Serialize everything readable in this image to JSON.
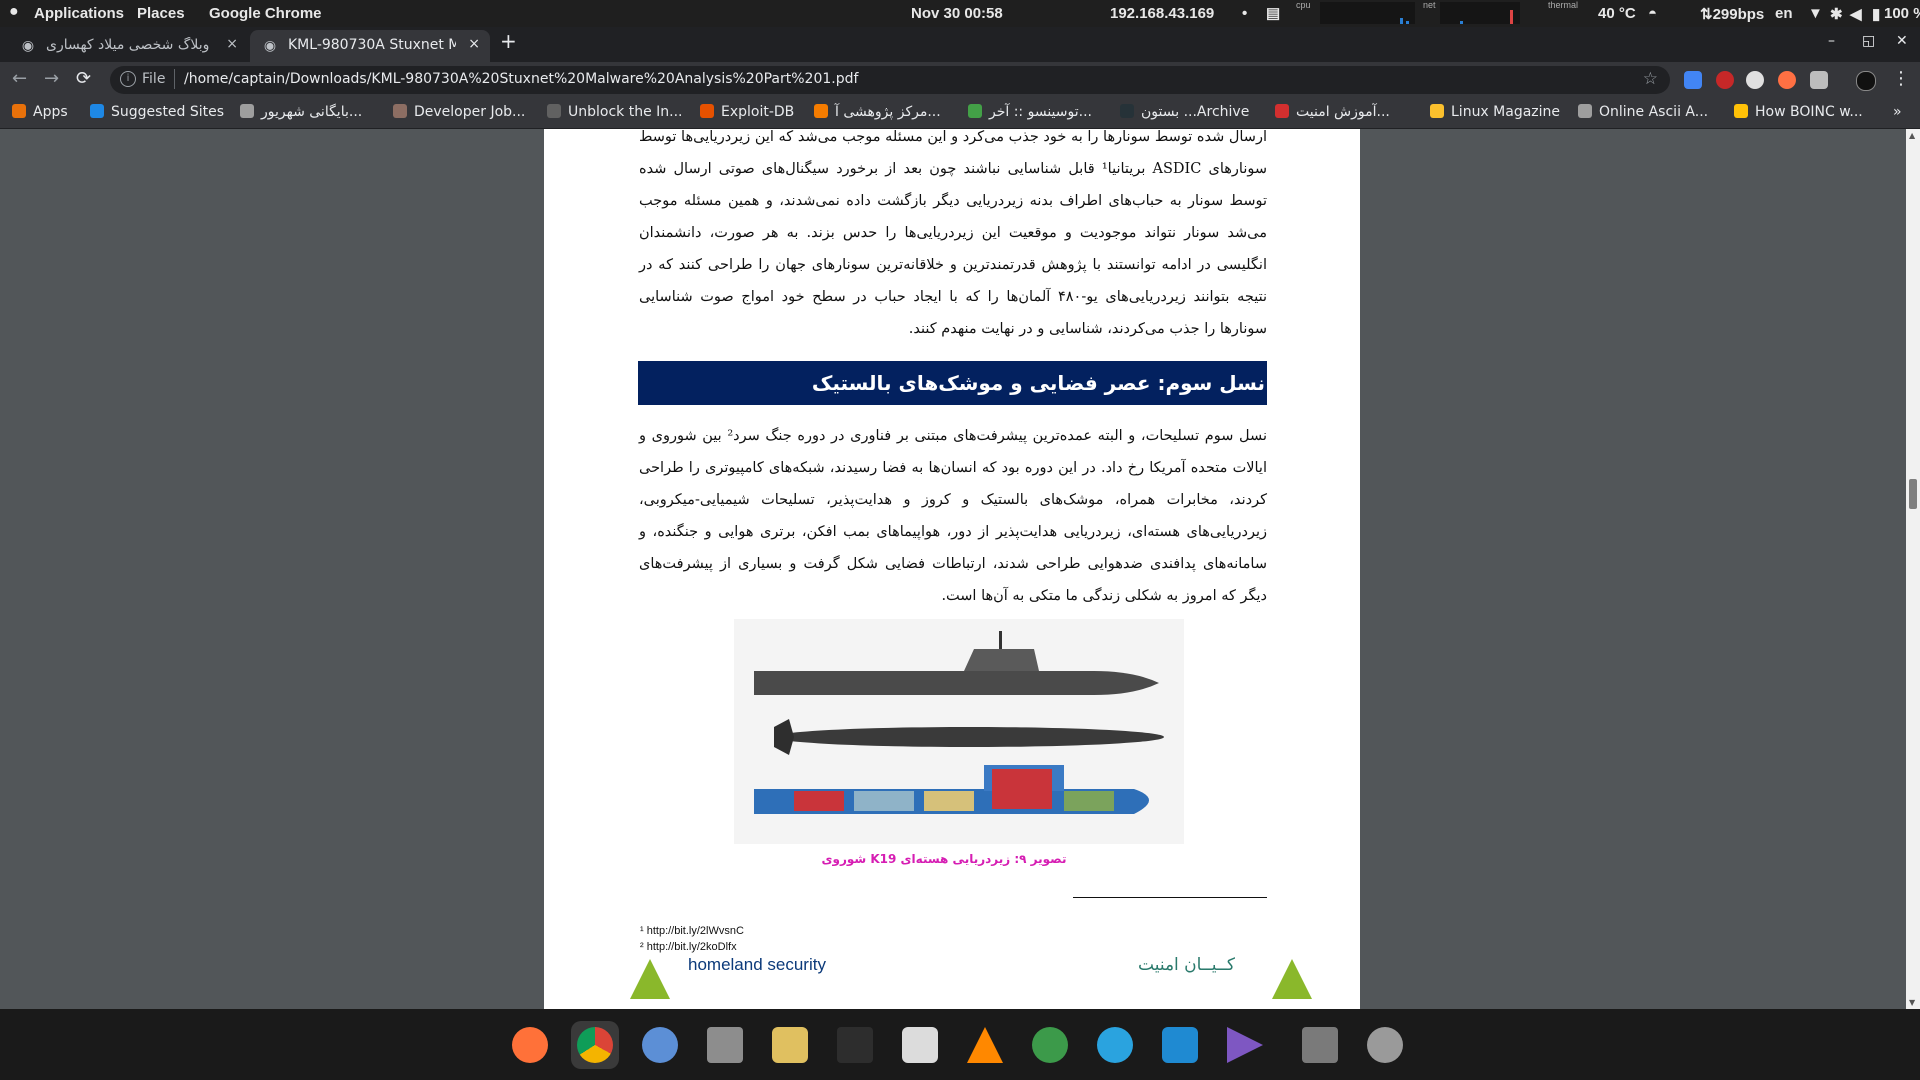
{
  "topbar": {
    "applications": "Applications",
    "places": "Places",
    "app_name": "Google Chrome",
    "datetime": "Nov 30  00:58",
    "ip": "192.168.43.169",
    "cpu_label": "cpu",
    "net_label": "net",
    "thermal_label": "thermal",
    "temperature": "40 °C",
    "net_speed": "⇅299bps",
    "lang": "en",
    "battery": "100 %"
  },
  "tabs": [
    {
      "title": "وبلاگ شخصی میلاد کهساری",
      "close": "×"
    },
    {
      "title": "KML-980730A Stuxnet Ma",
      "close": "×"
    }
  ],
  "new_tab": "+",
  "window_controls": {
    "minimize": "–",
    "maximize": "◱",
    "close": "✕"
  },
  "toolbar": {
    "back": "←",
    "forward": "→",
    "reload": "⟳",
    "scheme": "File",
    "url": "/home/captain/Downloads/KML-980730A%20Stuxnet%20Malware%20Analysis%20Part%201.pdf",
    "star": "☆",
    "menu": "⋮"
  },
  "bookmarks": [
    {
      "label": "Apps",
      "color": "#e8710a"
    },
    {
      "label": "Suggested Sites",
      "color": "#1e88e5"
    },
    {
      "label": "بایگانی شهریور...",
      "color": "#9e9e9e"
    },
    {
      "label": "Developer Job...",
      "color": "#8d6e63"
    },
    {
      "label": "Unblock the In...",
      "color": "#616161"
    },
    {
      "label": "Exploit-DB",
      "color": "#e65100"
    },
    {
      "label": "مرکز پژوهشی آ...",
      "color": "#f57c00"
    },
    {
      "label": "توسینسو :: آخر...",
      "color": "#43a047"
    },
    {
      "label": "بستون ...Archive",
      "color": "#263238"
    },
    {
      "label": "آموزش امنیت...",
      "color": "#d32f2f"
    },
    {
      "label": "Linux Magazine",
      "color": "#fbc02d"
    },
    {
      "label": "Online Ascii A...",
      "color": "#9e9e9e"
    },
    {
      "label": "How BOINC w...",
      "color": "#ffc107"
    }
  ],
  "bookmarks_more": "»",
  "pdf": {
    "paragraph1": "ارسال شده توسط سونارها را به خود جذب می‌کرد و این مسئله موجب می‌شد که این زیردریایی‌ها توسط سونارهای ASDIC بریتانیا¹ قابل شناسایی نباشند چون بعد از برخورد سیگنال‌های صوتی ارسال شده توسط سونار به حباب‌های اطراف بدنه زیردریایی دیگر بازگشت داده نمی‌شدند، و همین مسئله موجب می‌شد سونار نتواند موجودیت و موقعیت این زیردریایی‌ها را حدس بزند. به هر صورت، دانشمندان انگلیسی در ادامه توانستند با پژوهش قدرتمندترین و خلاقانه‌ترین سونارهای جهان را طراحی کنند که در نتیجه بتوانند زیردریایی‌های یو-۴۸۰ آلمان‌ها را که با ایجاد حباب در سطح خود امواج صوت شناسایی سونارها را جذب می‌کردند، شناسایی و در نهایت منهدم کنند.",
    "heading": "نسل سوم: عصر فضایی و موشک‌های بالستیک",
    "paragraph2": "نسل سوم تسلیحات، و البته عمده‌ترین پیشرفت‌های مبتنی بر فناوری در دوره جنگ سرد² بین شوروی و ایالات متحده آمریکا رخ داد. در این دوره بود که انسان‌ها به فضا رسیدند، شبکه‌های کامپیوتری را طراحی کردند، مخابرات همراه، موشک‌های بالستیک و کروز و هدایت‌پذیر، تسلیحات شیمیایی-میکروبی، زیردریایی‌های هسته‌ای، زیردریایی هدایت‌پذیر از دور، هواپیماهای بمب افکن، برتری هوایی و جنگنده، و سامانه‌های پدافندی ضدهوایی طراحی شدند، ارتباطات فضایی شکل گرفت و بسیاری از پیشرفت‌های دیگر که امروز به شکلی زندگی ما متکی به آن‌ها است.",
    "caption": "تصویر ۹: زیردریایی هسته‌ای K19 شوروی",
    "footnote1": "¹ http://bit.ly/2lWvsnC",
    "footnote2": "² http://bit.ly/2koDlfx",
    "logo_left_text": "homeland security",
    "logo_right_text": "کــیــان امنیت"
  },
  "dock": [
    {
      "name": "firefox",
      "color": "#ff7139"
    },
    {
      "name": "chrome",
      "color": "#4caf50"
    },
    {
      "name": "thunderbird",
      "color": "#5c8fd6"
    },
    {
      "name": "files",
      "color": "#8d8d8d"
    },
    {
      "name": "rhythmbox",
      "color": "#e0c060"
    },
    {
      "name": "terminal",
      "color": "#2d2d2d"
    },
    {
      "name": "software",
      "color": "#dcdcdc"
    },
    {
      "name": "vlc",
      "color": "#ff8800"
    },
    {
      "name": "krita",
      "color": "#3c9a4a"
    },
    {
      "name": "telegram",
      "color": "#2aa3df"
    },
    {
      "name": "vscode",
      "color": "#1f8ad2"
    },
    {
      "name": "play",
      "color": "#7e57c2"
    },
    {
      "name": "trash",
      "color": "#7a7a7a"
    },
    {
      "name": "launcher",
      "color": "#9a9a9a"
    }
  ]
}
